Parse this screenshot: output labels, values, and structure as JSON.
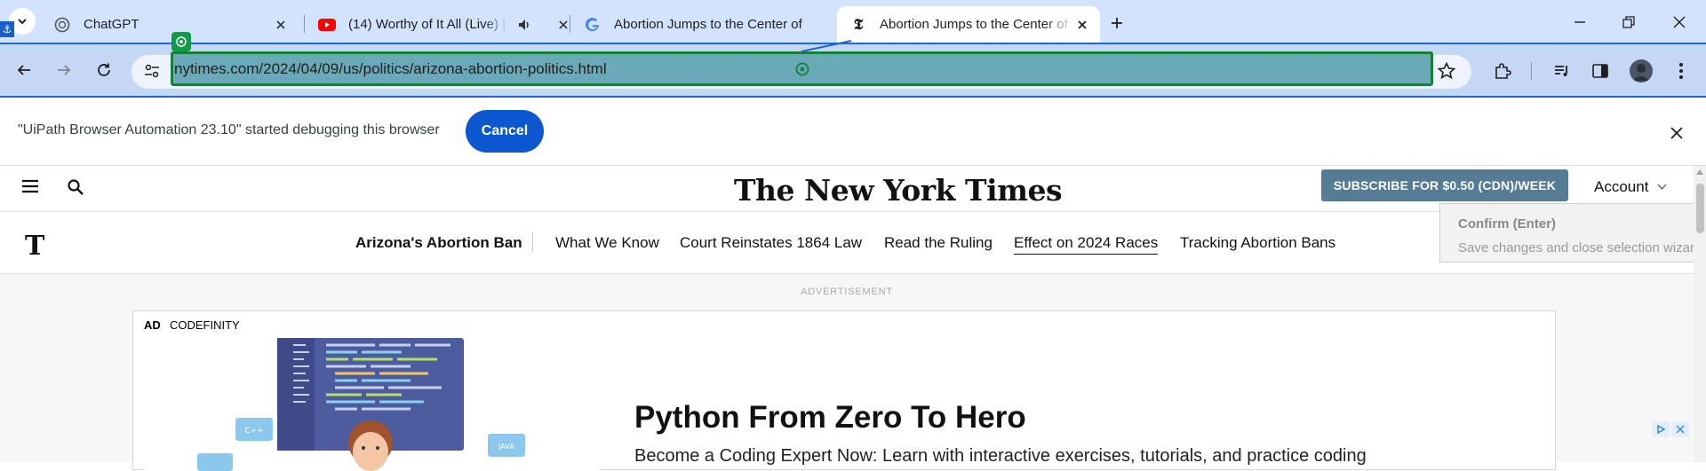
{
  "browser": {
    "tabs": [
      {
        "title": "ChatGPT",
        "favicon": "chatgpt-icon"
      },
      {
        "title": "(14) Worthy of It All (Live) |",
        "favicon": "youtube-icon",
        "audio": true
      },
      {
        "title": "Abortion Jumps to the Center of",
        "favicon": "google-icon"
      },
      {
        "title": "Abortion Jumps to the Center of",
        "favicon": "nyt-icon",
        "active": true
      }
    ],
    "url": "nytimes.com/2024/04/09/us/politics/arizona-abortion-politics.html"
  },
  "infobar": {
    "message": "\"UiPath Browser Automation 23.10\" started debugging this browser",
    "cancel_label": "Cancel"
  },
  "masthead": {
    "logo": "The New York Times",
    "subscribe_label": "SUBSCRIBE FOR $0.50 (CDN)/WEEK",
    "account_label": "Account"
  },
  "nav": {
    "logo_letter": "T",
    "section_title": "Arizona's Abortion Ban",
    "items": [
      "What We Know",
      "Court Reinstates 1864 Law",
      "Read the Ruling",
      "Effect on 2024 Races",
      "Tracking Abortion Bans"
    ]
  },
  "tooltip": {
    "title": "Confirm (Enter)",
    "description": "Save changes and close selection wizard."
  },
  "ad": {
    "label": "ADVERTISEMENT",
    "tag": "AD",
    "sponsor": "CODEFINITY",
    "headline": "Python From Zero To Hero",
    "subtext": "Become a Coding Expert Now: Learn with interactive exercises, tutorials, and practice coding"
  },
  "colors": {
    "tabstrip_bg": "#d3e3fd",
    "toolbar_bg": "#c6d7f5",
    "url_highlight": "#6aa9b7",
    "uipath_green": "#16803a",
    "cancel_blue": "#0b57d0",
    "subscribe_bg": "#567b95"
  }
}
